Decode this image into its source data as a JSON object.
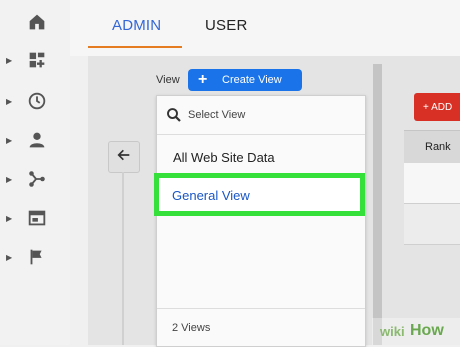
{
  "sidebar": {
    "items": [
      {
        "icon": "home-icon",
        "has_arrow": false
      },
      {
        "icon": "dashboard-add-icon",
        "has_arrow": true
      },
      {
        "icon": "clock-icon",
        "has_arrow": true
      },
      {
        "icon": "person-icon",
        "has_arrow": true
      },
      {
        "icon": "share-nodes-icon",
        "has_arrow": true
      },
      {
        "icon": "window-icon",
        "has_arrow": true
      },
      {
        "icon": "flag-icon",
        "has_arrow": true
      }
    ]
  },
  "tabs": {
    "admin": "ADMIN",
    "user": "USER",
    "active": "admin"
  },
  "view": {
    "label": "View",
    "create_button": "Create View",
    "search_placeholder": "Select View",
    "items": [
      "All Web Site Data",
      "General View"
    ],
    "selected": "General View",
    "footer": "2 Views"
  },
  "right": {
    "add_button": "+ ADD",
    "column_header": "Rank"
  },
  "watermark": {
    "wiki": "wiki",
    "how": "How"
  },
  "colors": {
    "accent_blue": "#1a73e8",
    "highlight_green": "#35e03a",
    "tab_underline": "#e67c22",
    "add_red": "#d93025"
  }
}
